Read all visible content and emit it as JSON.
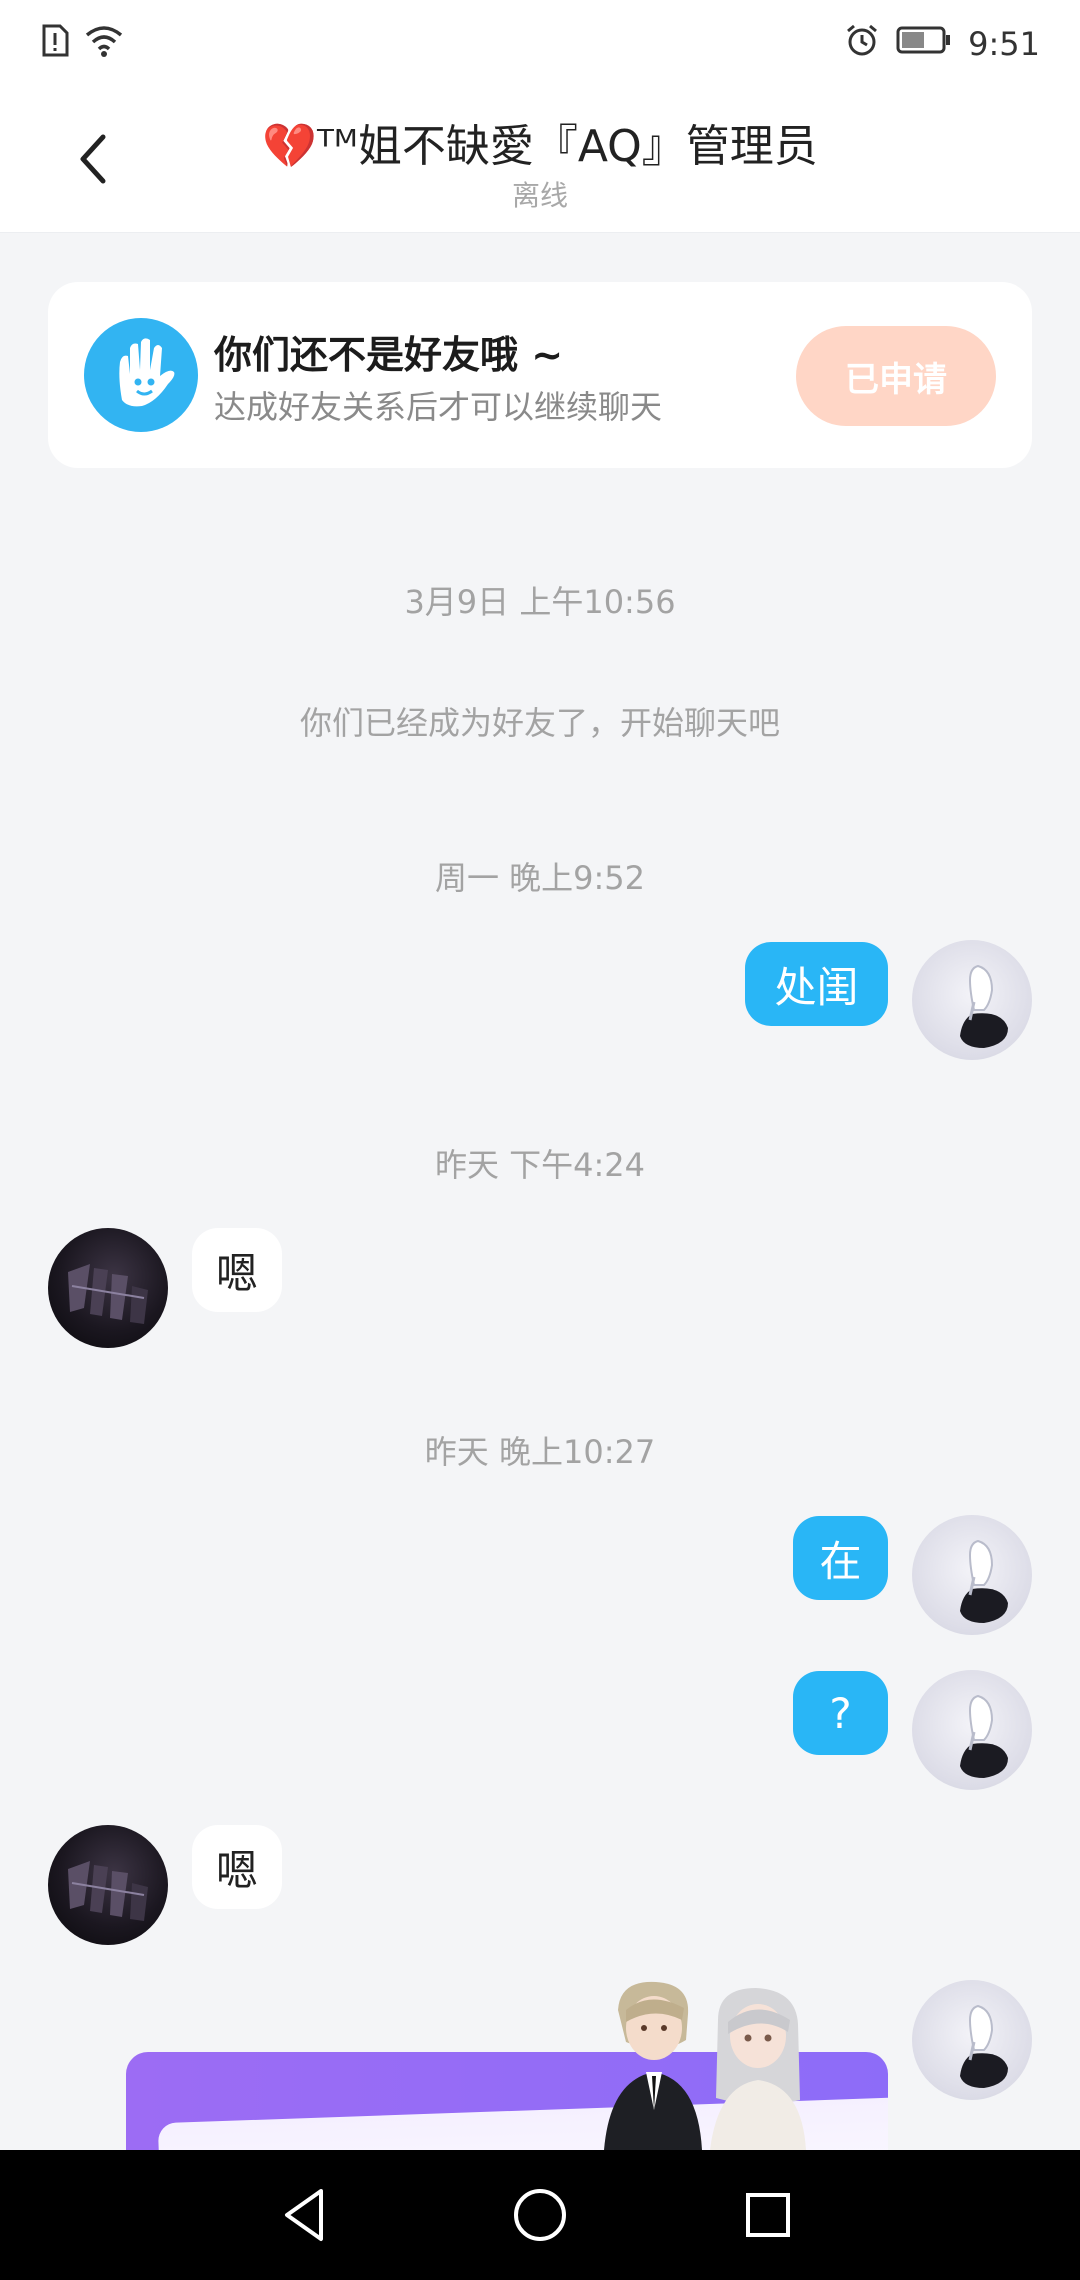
{
  "status_bar": {
    "time": "9:51",
    "icons": [
      "sim-alert-icon",
      "wifi-icon",
      "alarm-icon",
      "battery-icon"
    ]
  },
  "header": {
    "title": "💔ᵀᴹ姐不缺愛『AQ』管理员",
    "subtitle": "离线"
  },
  "notice": {
    "title": "你们还不是好友哦 ~",
    "subtitle": "达成好友关系后才可以继续聊天",
    "button_label": "已申请",
    "icon": "hand-wave-icon"
  },
  "messages": {
    "ts1": "3月9日 上午10:56",
    "system_msg": "你们已经成为好友了，开始聊天吧",
    "ts2": "周一 晚上9:52",
    "m1": "处闺",
    "ts3": "昨天 下午4:24",
    "m2": "嗯",
    "ts4": "昨天 晚上10:27",
    "m3": "在",
    "m4": "?",
    "m5": "嗯"
  },
  "nav": {
    "icons": [
      "back-triangle-icon",
      "home-circle-icon",
      "recents-square-icon"
    ]
  },
  "colors": {
    "accent": "#29b6f6",
    "applied_button": "#ffd6c6",
    "background": "#f4f5f7",
    "promo": "#9c6cf4"
  }
}
